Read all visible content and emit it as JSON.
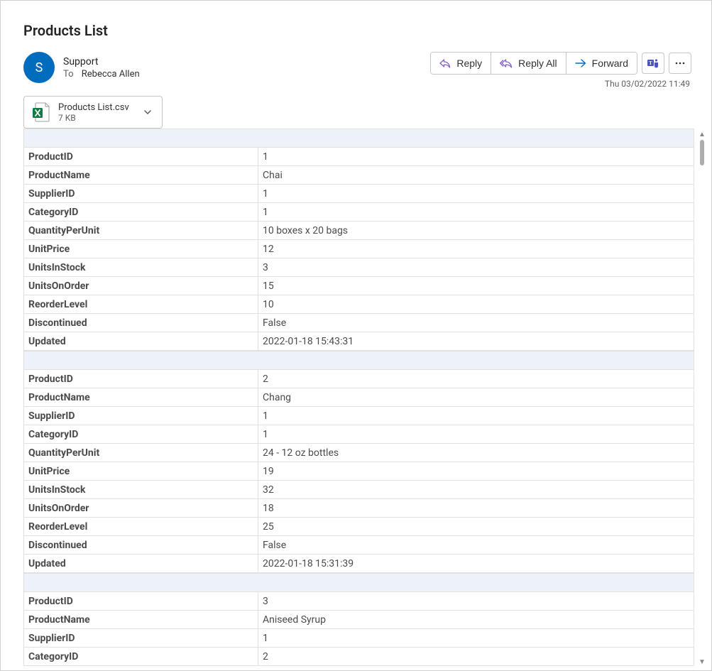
{
  "subject": "Products List",
  "avatar_initial": "S",
  "from_name": "Support",
  "to_label": "To",
  "to_name": "Rebecca Allen",
  "timestamp": "Thu 03/02/2022 11:49",
  "actions": {
    "reply": "Reply",
    "reply_all": "Reply All",
    "forward": "Forward"
  },
  "attachment": {
    "name": "Products List.csv",
    "size": "7 KB"
  },
  "field_labels": {
    "ProductID": "ProductID",
    "ProductName": "ProductName",
    "SupplierID": "SupplierID",
    "CategoryID": "CategoryID",
    "QuantityPerUnit": "QuantityPerUnit",
    "UnitPrice": "UnitPrice",
    "UnitsInStock": "UnitsInStock",
    "UnitsOnOrder": "UnitsOnOrder",
    "ReorderLevel": "ReorderLevel",
    "Discontinued": "Discontinued",
    "Updated": "Updated"
  },
  "records": [
    {
      "ProductID": "1",
      "ProductName": "Chai",
      "SupplierID": "1",
      "CategoryID": "1",
      "QuantityPerUnit": "10 boxes x 20 bags",
      "UnitPrice": "12",
      "UnitsInStock": "3",
      "UnitsOnOrder": "15",
      "ReorderLevel": "10",
      "Discontinued": "False",
      "Updated": "2022-01-18 15:43:31"
    },
    {
      "ProductID": "2",
      "ProductName": "Chang",
      "SupplierID": "1",
      "CategoryID": "1",
      "QuantityPerUnit": "24 - 12 oz bottles",
      "UnitPrice": "19",
      "UnitsInStock": "32",
      "UnitsOnOrder": "18",
      "ReorderLevel": "25",
      "Discontinued": "False",
      "Updated": "2022-01-18 15:31:39"
    },
    {
      "ProductID": "3",
      "ProductName": "Aniseed Syrup",
      "SupplierID": "1",
      "CategoryID": "2"
    }
  ],
  "record3_visible_keys": [
    "ProductID",
    "ProductName",
    "SupplierID",
    "CategoryID"
  ]
}
